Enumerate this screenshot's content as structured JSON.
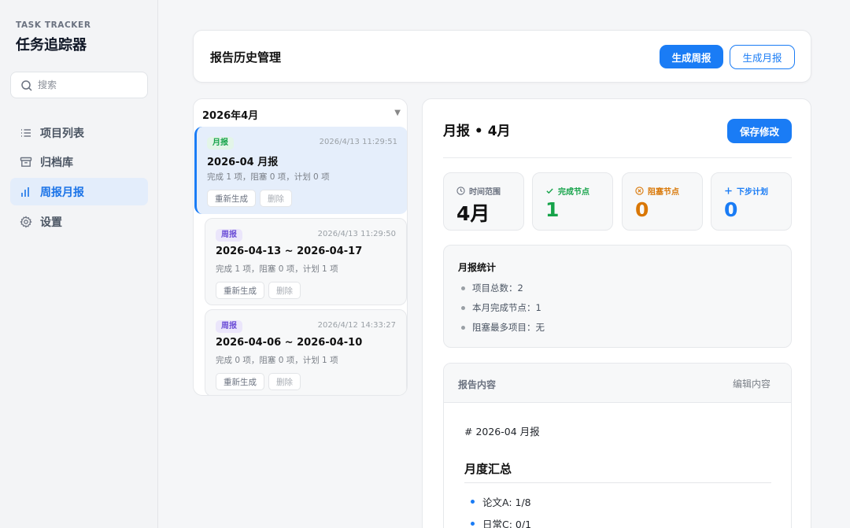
{
  "sidebar": {
    "brand_sub": "TASK TRACKER",
    "brand_title": "任务追踪器",
    "search_placeholder": "搜索",
    "nav": [
      {
        "label": "项目列表",
        "icon": "list-icon"
      },
      {
        "label": "归档库",
        "icon": "archive-icon"
      },
      {
        "label": "周报月报",
        "icon": "bar-chart-icon"
      },
      {
        "label": "设置",
        "icon": "gear-icon"
      }
    ],
    "active_index": 2
  },
  "header": {
    "title": "报告历史管理",
    "btn_weekly": "生成周报",
    "btn_monthly": "生成月报"
  },
  "list": {
    "month_label": "2026年4月",
    "items": [
      {
        "type": "月报",
        "timestamp": "2026/4/13 11:29:51",
        "title": "2026-04 月报",
        "stats": "完成 1 项，阻塞 0 项，计划 0 项",
        "regen": "重新生成",
        "delete": "删除"
      },
      {
        "type": "周报",
        "timestamp": "2026/4/13 11:29:50",
        "title": "2026-04-13 ~ 2026-04-17",
        "stats": "完成 1 项，阻塞 0 项，计划 1 项",
        "regen": "重新生成",
        "delete": "删除"
      },
      {
        "type": "周报",
        "timestamp": "2026/4/12 14:33:27",
        "title": "2026-04-06 ~ 2026-04-10",
        "stats": "完成 0 项，阻塞 0 项，计划 1 项",
        "regen": "重新生成",
        "delete": "删除"
      }
    ]
  },
  "detail": {
    "title": "月报 • 4月",
    "save_label": "保存修改",
    "stats": [
      {
        "label": "时间范围",
        "value": "4月",
        "color": "#111111",
        "icon": "clock-icon"
      },
      {
        "label": "完成节点",
        "value": "1",
        "color": "#16a34a",
        "icon": "check-icon"
      },
      {
        "label": "阻塞节点",
        "value": "0",
        "color": "#d97706",
        "icon": "circle-x-icon"
      },
      {
        "label": "下步计划",
        "value": "0",
        "color": "#1a7cf5",
        "icon": "plus-icon"
      }
    ],
    "summary": {
      "title": "月报统计",
      "lines": [
        "项目总数：2",
        "本月完成节点：1",
        "阻塞最多项目：无"
      ]
    },
    "content": {
      "label": "报告内容",
      "edit_label": "编辑内容",
      "h1": "# 2026-04 月报",
      "h2": "月度汇总",
      "items": [
        "论文A: 1/8",
        "日常C: 0/1"
      ]
    }
  },
  "colors": {
    "accent": "#1a7cf5",
    "done": "#16a34a",
    "blocked": "#d97706"
  }
}
